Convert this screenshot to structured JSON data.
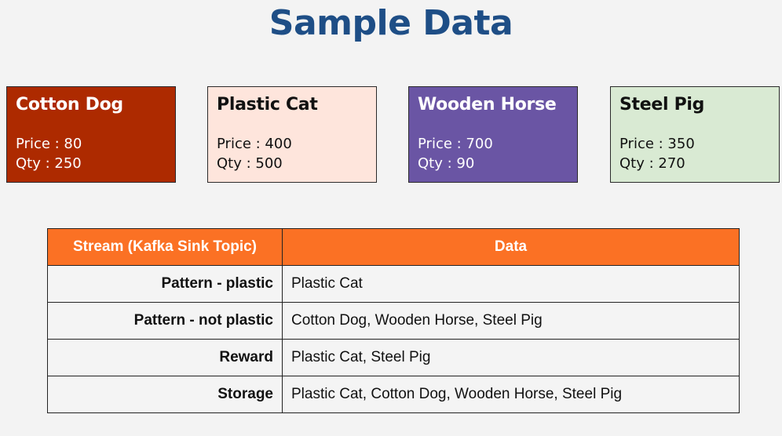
{
  "title": "Sample Data",
  "cards": [
    {
      "name": "Cotton Dog",
      "price": "Price : 80",
      "qty": "Qty : 250",
      "bg": "#ad2a00",
      "fg": "#ffffff"
    },
    {
      "name": "Plastic Cat",
      "price": "Price : 400",
      "qty": "Qty : 500",
      "bg": "#fee5dc",
      "fg": "#111111"
    },
    {
      "name": "Wooden Horse",
      "price": "Price : 700",
      "qty": "Qty : 90",
      "bg": "#6a55a4",
      "fg": "#ffffff"
    },
    {
      "name": "Steel Pig",
      "price": "Price : 350",
      "qty": "Qty : 270",
      "bg": "#d9ead3",
      "fg": "#111111"
    }
  ],
  "table": {
    "headers": [
      "Stream (Kafka Sink Topic)",
      "Data"
    ],
    "header_color": "#fb7124",
    "rows": [
      {
        "stream": "Pattern - plastic",
        "data": "Plastic Cat"
      },
      {
        "stream": "Pattern - not plastic",
        "data": "Cotton Dog, Wooden Horse, Steel Pig"
      },
      {
        "stream": "Reward",
        "data": "Plastic Cat, Steel Pig"
      },
      {
        "stream": "Storage",
        "data": "Plastic Cat, Cotton Dog, Wooden Horse, Steel Pig"
      }
    ]
  }
}
